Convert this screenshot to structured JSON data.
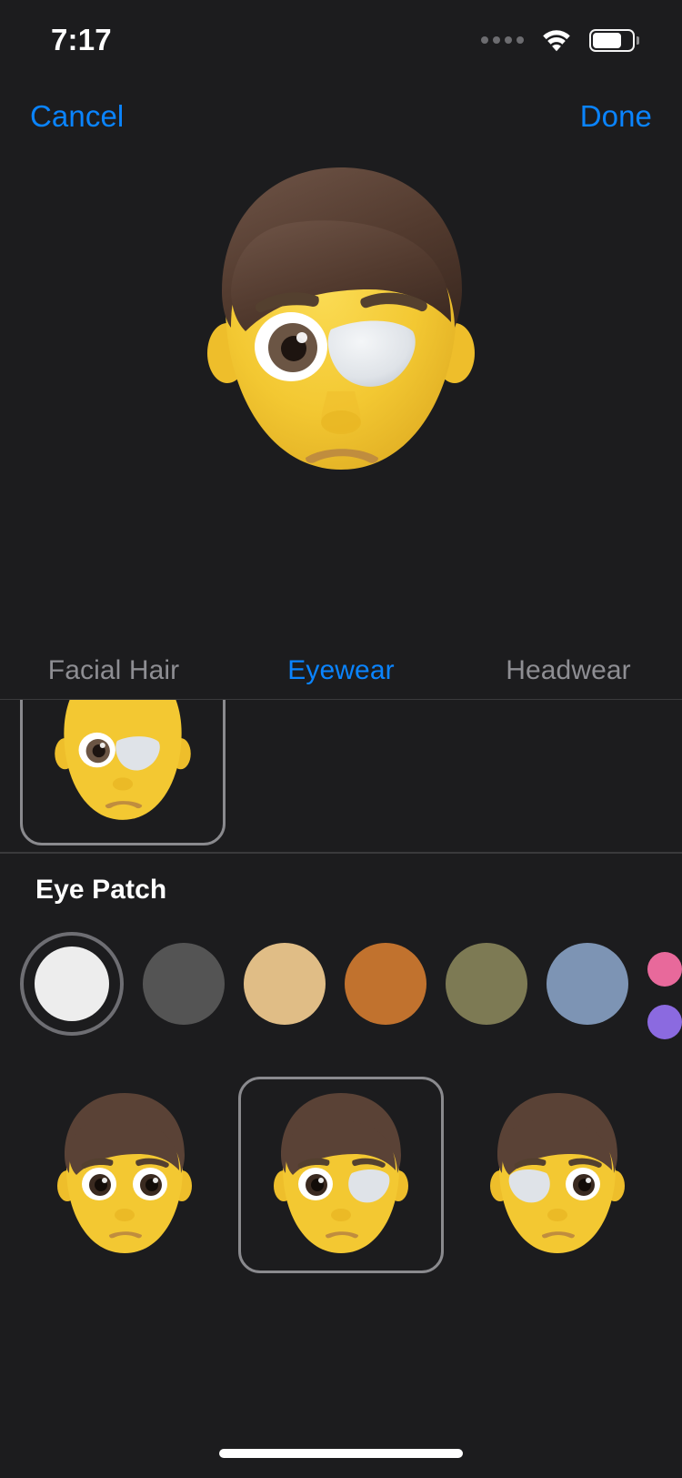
{
  "status_bar": {
    "time": "7:17",
    "cellular_icon": "cellular-dots-icon",
    "wifi_icon": "wifi-icon",
    "battery_icon": "battery-icon",
    "battery_level_percent": 75
  },
  "nav_bar": {
    "cancel_label": "Cancel",
    "done_label": "Done",
    "accent_color": "#0a84ff"
  },
  "preview": {
    "avatar_name": "memoji-preview",
    "skin_color": "#f5cf3f",
    "hair_color": "#5a4236",
    "patch_color": "#e4e6ea",
    "eye_color": "#6b5544",
    "patch_side": "right"
  },
  "tabs": [
    {
      "label": "Facial Hair",
      "active": false
    },
    {
      "label": "Eyewear",
      "active": true
    },
    {
      "label": "Headwear",
      "active": false
    }
  ],
  "option_strip": {
    "items": [
      {
        "name": "eye-patch-option",
        "selected": true,
        "patch_side": "right"
      }
    ]
  },
  "color_section": {
    "title": "Eye Patch",
    "selected_index": 0,
    "swatches": [
      {
        "name": "white",
        "hex": "#ededed",
        "selected": true
      },
      {
        "name": "dark-gray",
        "hex": "#545454",
        "selected": false
      },
      {
        "name": "tan",
        "hex": "#e0bd86",
        "selected": false
      },
      {
        "name": "orange-brown",
        "hex": "#c1722e",
        "selected": false
      },
      {
        "name": "olive",
        "hex": "#7d7a54",
        "selected": false
      },
      {
        "name": "blue-gray",
        "hex": "#7d94b4",
        "selected": false
      },
      {
        "name": "pink",
        "hex": "#e8699b",
        "selected": false
      },
      {
        "name": "purple",
        "hex": "#8b6ae0",
        "selected": false
      }
    ]
  },
  "variants": [
    {
      "name": "no-patch",
      "selected": false,
      "patch_side": "none"
    },
    {
      "name": "patch-right-eye",
      "selected": true,
      "patch_side": "right"
    },
    {
      "name": "patch-left-eye",
      "selected": false,
      "patch_side": "left"
    }
  ],
  "home_indicator": {
    "name": "home-indicator"
  },
  "theme": {
    "background": "#1c1c1e",
    "divider": "#3a3a3c",
    "selection_border": "#8a8a8e",
    "inactive_text": "#8e8e93"
  }
}
